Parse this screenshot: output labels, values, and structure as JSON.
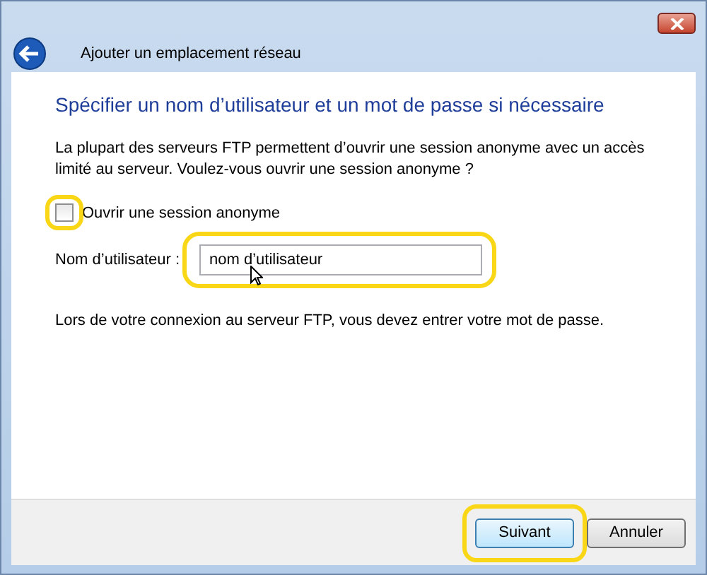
{
  "window": {
    "title": "Ajouter un emplacement réseau"
  },
  "heading": "Spécifier un nom d’utilisateur et un mot de passe si nécessaire",
  "intro": "La plupart des serveurs FTP permettent d’ouvrir une session anonyme avec un accès limité au serveur. Voulez-vous ouvrir une session anonyme ?",
  "anonymous": {
    "label": "Ouvrir une session anonyme",
    "checked": false,
    "highlighted": true
  },
  "username": {
    "label": "Nom d’utilisateur :",
    "value": "nom d’utilisateur",
    "highlighted": true
  },
  "note": "Lors de votre connexion au serveur FTP, vous devez entrer votre mot de passe.",
  "buttons": [
    {
      "label": "Suivant",
      "kind": "default",
      "highlighted": true
    },
    {
      "label": "Annuler",
      "kind": "normal",
      "highlighted": false
    }
  ]
}
